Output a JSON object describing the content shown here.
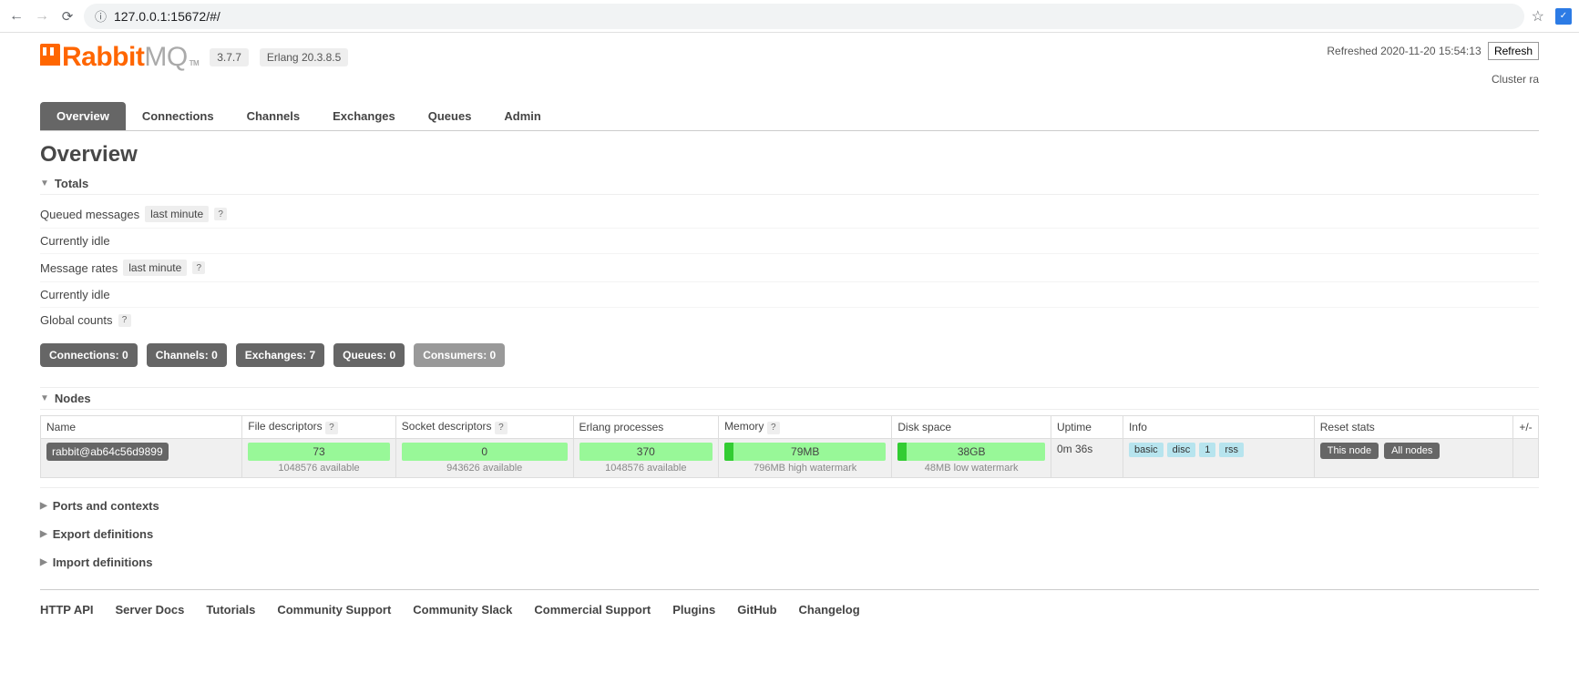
{
  "browser": {
    "url": "127.0.0.1:15672/#/"
  },
  "header": {
    "logo_rabbit": "Rabbit",
    "logo_mq": "MQ",
    "logo_tm": "TM",
    "version": "3.7.7",
    "erlang": "Erlang 20.3.8.5",
    "refreshed_label": "Refreshed 2020-11-20 15:54:13",
    "refresh_btn": "Refresh",
    "cluster_label": "Cluster ra"
  },
  "tabs": [
    "Overview",
    "Connections",
    "Channels",
    "Exchanges",
    "Queues",
    "Admin"
  ],
  "page_title": "Overview",
  "totals": {
    "section": "Totals",
    "queued_label": "Queued messages",
    "last_minute": "last minute",
    "idle1": "Currently idle",
    "rates_label": "Message rates",
    "idle2": "Currently idle",
    "global_label": "Global counts",
    "help": "?"
  },
  "counts": {
    "connections_label": "Connections:",
    "connections_val": "0",
    "channels_label": "Channels:",
    "channels_val": "0",
    "exchanges_label": "Exchanges:",
    "exchanges_val": "7",
    "queues_label": "Queues:",
    "queues_val": "0",
    "consumers_label": "Consumers:",
    "consumers_val": "0"
  },
  "nodes": {
    "section": "Nodes",
    "corner": "+/-",
    "headers": {
      "name": "Name",
      "fd": "File descriptors",
      "sd": "Socket descriptors",
      "ep": "Erlang processes",
      "mem": "Memory",
      "disk": "Disk space",
      "uptime": "Uptime",
      "info": "Info",
      "reset": "Reset stats"
    },
    "help": "?",
    "row": {
      "name": "rabbit@ab64c56d9899",
      "fd_val": "73",
      "fd_sub": "1048576 available",
      "sd_val": "0",
      "sd_sub": "943626 available",
      "ep_val": "370",
      "ep_sub": "1048576 available",
      "mem_val": "79MB",
      "mem_sub": "796MB high watermark",
      "disk_val": "38GB",
      "disk_sub": "48MB low watermark",
      "uptime": "0m 36s",
      "info_tags": [
        "basic",
        "disc",
        "1",
        "rss"
      ],
      "reset_this": "This node",
      "reset_all": "All nodes"
    }
  },
  "collapsed": {
    "ports": "Ports and contexts",
    "export": "Export definitions",
    "import": "Import definitions"
  },
  "footer": [
    "HTTP API",
    "Server Docs",
    "Tutorials",
    "Community Support",
    "Community Slack",
    "Commercial Support",
    "Plugins",
    "GitHub",
    "Changelog"
  ]
}
